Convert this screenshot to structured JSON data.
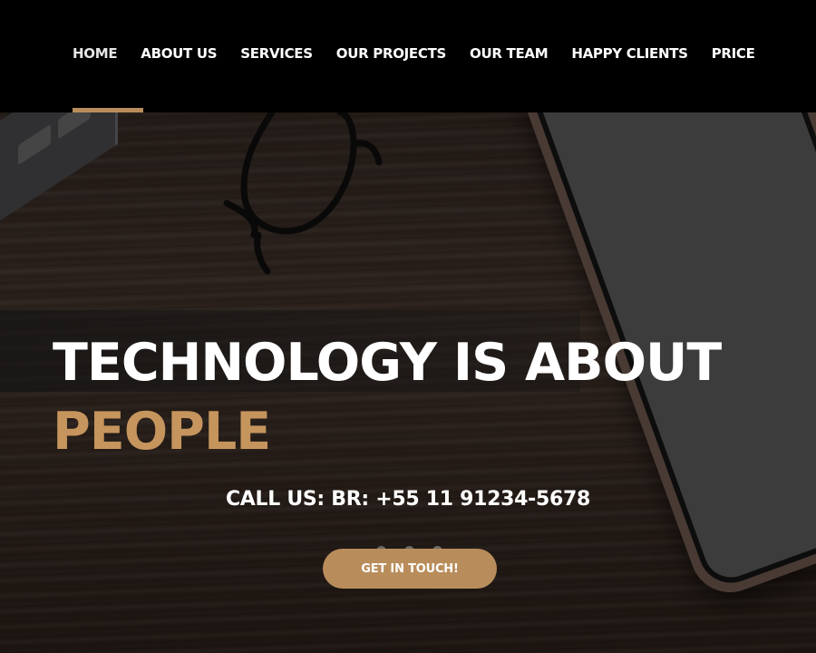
{
  "nav": {
    "items": [
      {
        "label": "HOME",
        "active": true
      },
      {
        "label": "ABOUT US",
        "active": false
      },
      {
        "label": "SERVICES",
        "active": false
      },
      {
        "label": "OUR PROJECTS",
        "active": false
      },
      {
        "label": "OUR TEAM",
        "active": false
      },
      {
        "label": "HAPPY CLIENTS",
        "active": false
      },
      {
        "label": "PRICE",
        "active": false
      }
    ]
  },
  "hero": {
    "headline_line1": "TECHNOLOGY IS ABOUT",
    "headline_line2": "PEOPLE",
    "call_us": "CALL US: BR: +55 11 91234-5678",
    "cta_label": "GET IN TOUCH!"
  },
  "colors": {
    "accent": "#b98d5b",
    "headline_accent": "#c5955d",
    "nav_background": "#000000"
  }
}
